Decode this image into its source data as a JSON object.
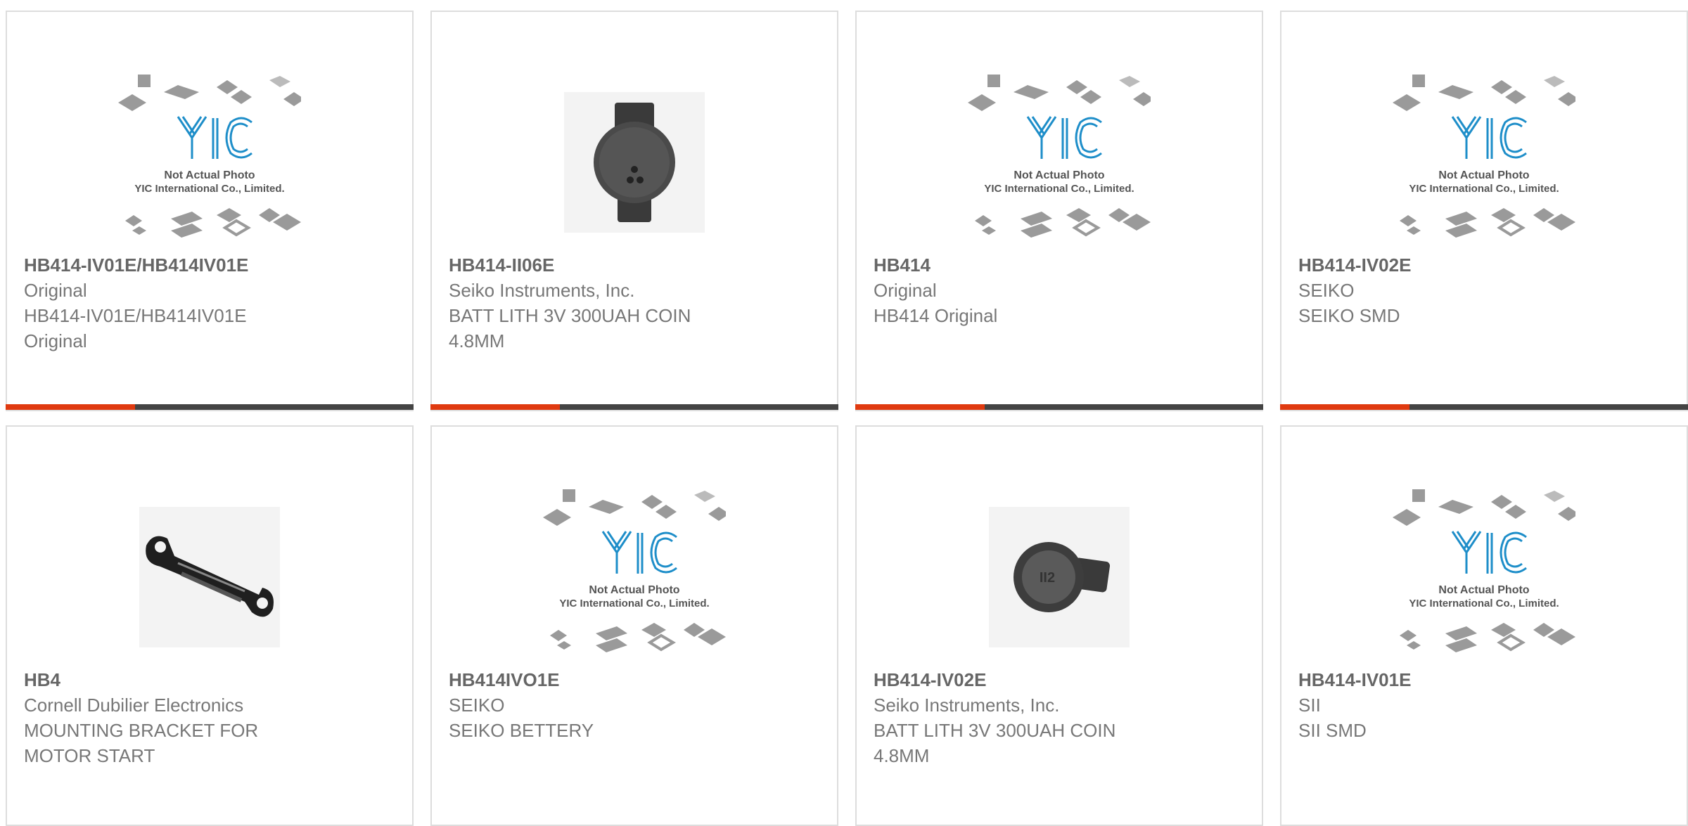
{
  "placeholder": {
    "logo": "YIC",
    "line1": "Not Actual Photo",
    "line2": "YIC International Co., Limited."
  },
  "colors": {
    "accent": "#e03a10",
    "bar": "#444444",
    "border": "#dddddd",
    "logo": "#1e8ec9"
  },
  "products": [
    {
      "part": "HB414-IV01E/HB414IV01E",
      "manufacturer": "Original",
      "description": "HB414-IV01E/HB414IV01E Original",
      "image": "placeholder"
    },
    {
      "part": "HB414-II06E",
      "manufacturer": "Seiko Instruments, Inc.",
      "description": "BATT LITH 3V 300UAH COIN 4.8MM",
      "image": "coin-cell-vertical"
    },
    {
      "part": "HB414",
      "manufacturer": "Original",
      "description": "HB414 Original",
      "image": "placeholder"
    },
    {
      "part": "HB414-IV02E",
      "manufacturer": "SEIKO",
      "description": "SEIKO SMD",
      "image": "placeholder"
    },
    {
      "part": "HB4",
      "manufacturer": "Cornell Dubilier Electronics",
      "description": "MOUNTING BRACKET FOR MOTOR START",
      "image": "mounting-bracket"
    },
    {
      "part": "HB414IVO1E",
      "manufacturer": "SEIKO",
      "description": "SEIKO BETTERY",
      "image": "placeholder"
    },
    {
      "part": "HB414-IV02E",
      "manufacturer": "Seiko Instruments, Inc.",
      "description": "BATT LITH 3V 300UAH COIN 4.8MM",
      "image": "coin-cell-horizontal"
    },
    {
      "part": "HB414-IV01E",
      "manufacturer": "SII",
      "description": "SII SMD",
      "image": "placeholder"
    }
  ]
}
